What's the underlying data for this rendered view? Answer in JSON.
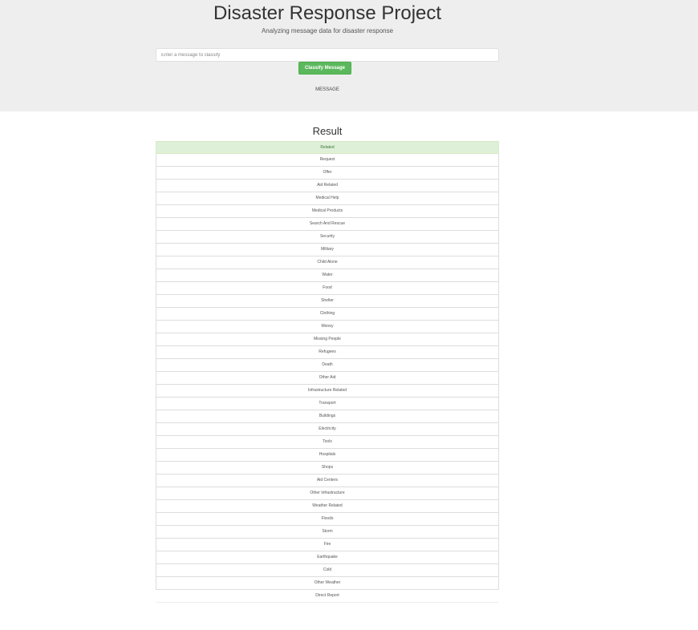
{
  "header": {
    "title": "Disaster Response Project",
    "subtitle": "Analyzing message data for disaster response"
  },
  "form": {
    "input_placeholder": "Enter a message to classify",
    "input_value": "",
    "classify_button_label": "Classify Message"
  },
  "message_caption": "MESSAGE",
  "result": {
    "heading": "Result",
    "categories": [
      {
        "label": "Related",
        "positive": true
      },
      {
        "label": "Request",
        "positive": false
      },
      {
        "label": "Offer",
        "positive": false
      },
      {
        "label": "Aid Related",
        "positive": false
      },
      {
        "label": "Medical Help",
        "positive": false
      },
      {
        "label": "Medical Products",
        "positive": false
      },
      {
        "label": "Search And Rescue",
        "positive": false
      },
      {
        "label": "Security",
        "positive": false
      },
      {
        "label": "Military",
        "positive": false
      },
      {
        "label": "Child Alone",
        "positive": false
      },
      {
        "label": "Water",
        "positive": false
      },
      {
        "label": "Food",
        "positive": false
      },
      {
        "label": "Shelter",
        "positive": false
      },
      {
        "label": "Clothing",
        "positive": false
      },
      {
        "label": "Money",
        "positive": false
      },
      {
        "label": "Missing People",
        "positive": false
      },
      {
        "label": "Refugees",
        "positive": false
      },
      {
        "label": "Death",
        "positive": false
      },
      {
        "label": "Other Aid",
        "positive": false
      },
      {
        "label": "Infrastructure Related",
        "positive": false
      },
      {
        "label": "Transport",
        "positive": false
      },
      {
        "label": "Buildings",
        "positive": false
      },
      {
        "label": "Electricity",
        "positive": false
      },
      {
        "label": "Tools",
        "positive": false
      },
      {
        "label": "Hospitals",
        "positive": false
      },
      {
        "label": "Shops",
        "positive": false
      },
      {
        "label": "Aid Centers",
        "positive": false
      },
      {
        "label": "Other Infrastructure",
        "positive": false
      },
      {
        "label": "Weather Related",
        "positive": false
      },
      {
        "label": "Floods",
        "positive": false
      },
      {
        "label": "Storm",
        "positive": false
      },
      {
        "label": "Fire",
        "positive": false
      },
      {
        "label": "Earthquake",
        "positive": false
      },
      {
        "label": "Cold",
        "positive": false
      },
      {
        "label": "Other Weather",
        "positive": false
      },
      {
        "label": "Direct Report",
        "positive": false
      }
    ]
  },
  "colors": {
    "jumbotron_bg": "#eeeeee",
    "button_green": "#5cb85c",
    "positive_row_bg": "#dff0d8"
  }
}
